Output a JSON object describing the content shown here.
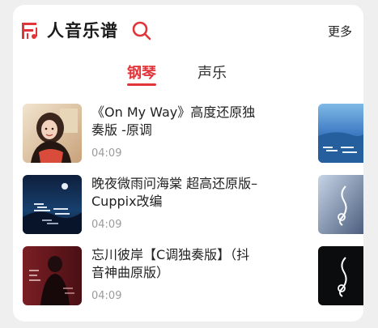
{
  "header": {
    "title": "人音乐谱",
    "more_label": "更多",
    "accent_color": "#e2353a"
  },
  "tabs": [
    {
      "label": "钢琴",
      "active": true
    },
    {
      "label": "声乐",
      "active": false
    }
  ],
  "songs": [
    {
      "title": "《On My Way》高度还原独奏版 -原调",
      "duration": "04:09"
    },
    {
      "title": "晚夜微雨问海棠 超高还原版–Cuppix改编",
      "duration": "04:09"
    },
    {
      "title": "忘川彼岸【C调独奏版】（抖音神曲原版）",
      "duration": "04:09"
    }
  ]
}
